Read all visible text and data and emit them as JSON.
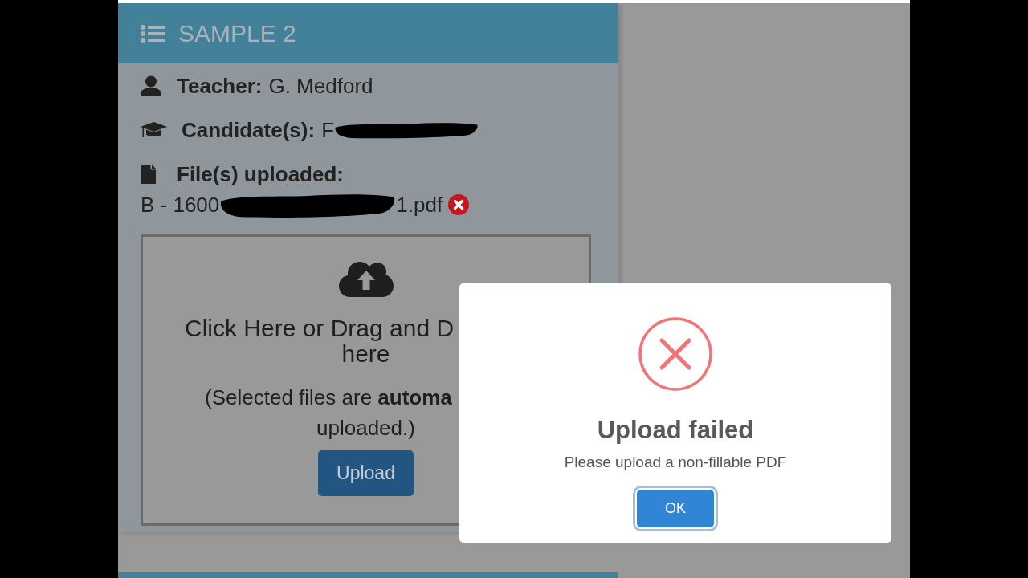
{
  "card": {
    "title": "SAMPLE 2",
    "details": [
      {
        "label": "Teacher:",
        "value": "G. Medford",
        "redacted": false
      },
      {
        "label": "Candidate(s):",
        "value": "F",
        "redacted": true
      },
      {
        "label": "File(s) uploaded:",
        "redacted": false
      }
    ],
    "files": [
      {
        "name_start": "B - 1600",
        "redacted": true,
        "name_end": "1.pdf"
      }
    ],
    "dropzone": {
      "instruction_lines": [
        "Click Here or Drag and D",
        "here"
      ],
      "note_lines": [
        "(Selected files are **automa**",
        "uploaded.)"
      ],
      "button": "Upload"
    }
  },
  "dialog": {
    "title": "Upload failed",
    "message": "Please upload a non-fillable PDF",
    "button": {
      "label": "OK",
      "focused": true
    }
  }
}
